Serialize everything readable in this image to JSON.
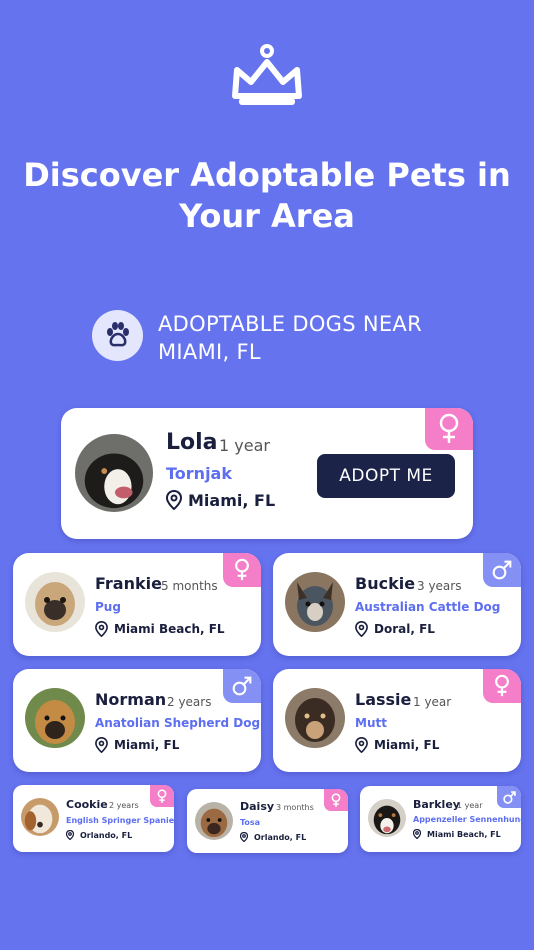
{
  "headline": "Discover Adoptable Pets in Your Area",
  "section_title": "ADOPTABLE DOGS NEAR MIAMI, FL",
  "adopt_label": "ADOPT ME",
  "featured": {
    "name": "Lola",
    "age": "1 year",
    "breed": "Tornjak",
    "location": "Miami, FL",
    "gender": "female"
  },
  "row1": [
    {
      "name": "Frankie",
      "age": "5 months",
      "breed": "Pug",
      "location": "Miami Beach, FL",
      "gender": "female"
    },
    {
      "name": "Buckie",
      "age": "3 years",
      "breed": "Australian Cattle Dog",
      "location": "Doral, FL",
      "gender": "male"
    }
  ],
  "row2": [
    {
      "name": "Norman",
      "age": "2 years",
      "breed": "Anatolian Shepherd Dog",
      "location": "Miami, FL",
      "gender": "male"
    },
    {
      "name": "Lassie",
      "age": "1 year",
      "breed": "Mutt",
      "location": "Miami, FL",
      "gender": "female"
    }
  ],
  "row3": [
    {
      "name": "Cookie",
      "age": "2 years",
      "breed": "English Springer Spaniel",
      "location": "Orlando, FL",
      "gender": "female"
    },
    {
      "name": "Daisy",
      "age": "3 months",
      "breed": "Tosa",
      "location": "Orlando, FL",
      "gender": "female"
    },
    {
      "name": "Barkley",
      "age": "1 year",
      "breed": "Appenzeller Sennenhund",
      "location": "Miami Beach, FL",
      "gender": "male"
    }
  ],
  "colors": {
    "background": "#6673ef",
    "female_badge": "#f47ec8",
    "male_badge": "#8490f3",
    "breed_text": "#5d6ef0",
    "button": "#1c2348"
  },
  "icons": {
    "logo": "crown-icon",
    "section": "paw-icon",
    "location": "location-pin-icon",
    "female": "female-symbol-icon",
    "male": "male-symbol-icon"
  }
}
